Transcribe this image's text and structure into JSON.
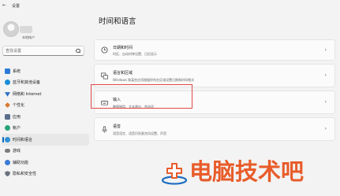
{
  "app": {
    "title": "设置"
  },
  "profile": {
    "account_type": "本地帐户"
  },
  "search": {
    "placeholder": "查找设置"
  },
  "sidebar": {
    "items": [
      {
        "label": "系统",
        "icon": "monitor-icon",
        "color": "#2b7bd6"
      },
      {
        "label": "蓝牙和其他设备",
        "icon": "bluetooth-icon",
        "color": "#1a8cd8"
      },
      {
        "label": "网络和 Internet",
        "icon": "wifi-icon",
        "color": "#2f6fc2"
      },
      {
        "label": "个性化",
        "icon": "brush-icon",
        "color": "#d97a33"
      },
      {
        "label": "应用",
        "icon": "apps-icon",
        "color": "#5b6e8c"
      },
      {
        "label": "帐户",
        "icon": "person-icon",
        "color": "#2aa374"
      },
      {
        "label": "时间和语言",
        "icon": "clock-globe-icon",
        "color": "#2f8fd6"
      },
      {
        "label": "游戏",
        "icon": "gamepad-icon",
        "color": "#7a7a7a"
      },
      {
        "label": "辅助功能",
        "icon": "accessibility-icon",
        "color": "#3a7bd5"
      },
      {
        "label": "隐私和安全性",
        "icon": "shield-icon",
        "color": "#6b7280"
      }
    ],
    "selected_index": 6
  },
  "main": {
    "title": "时间和语言",
    "cards": [
      {
        "title": "日期和时间",
        "subtitle": "时区、自动时钟设置、日历显示",
        "icon": "clock-icon"
      },
      {
        "title": "语言和区域",
        "subtitle": "Windows 和某些应用根据你所在区域设置日期和时间格式",
        "icon": "language-region-icon"
      },
      {
        "title": "输入",
        "subtitle": "触摸键盘、文本建议、首选项",
        "icon": "keyboard-icon"
      },
      {
        "title": "语音",
        "subtitle": "语音语言、语音识别麦克风设置、声音",
        "icon": "microphone-icon"
      }
    ]
  },
  "watermark": {
    "text": "电脑技术吧",
    "color": "#e85c2a"
  }
}
